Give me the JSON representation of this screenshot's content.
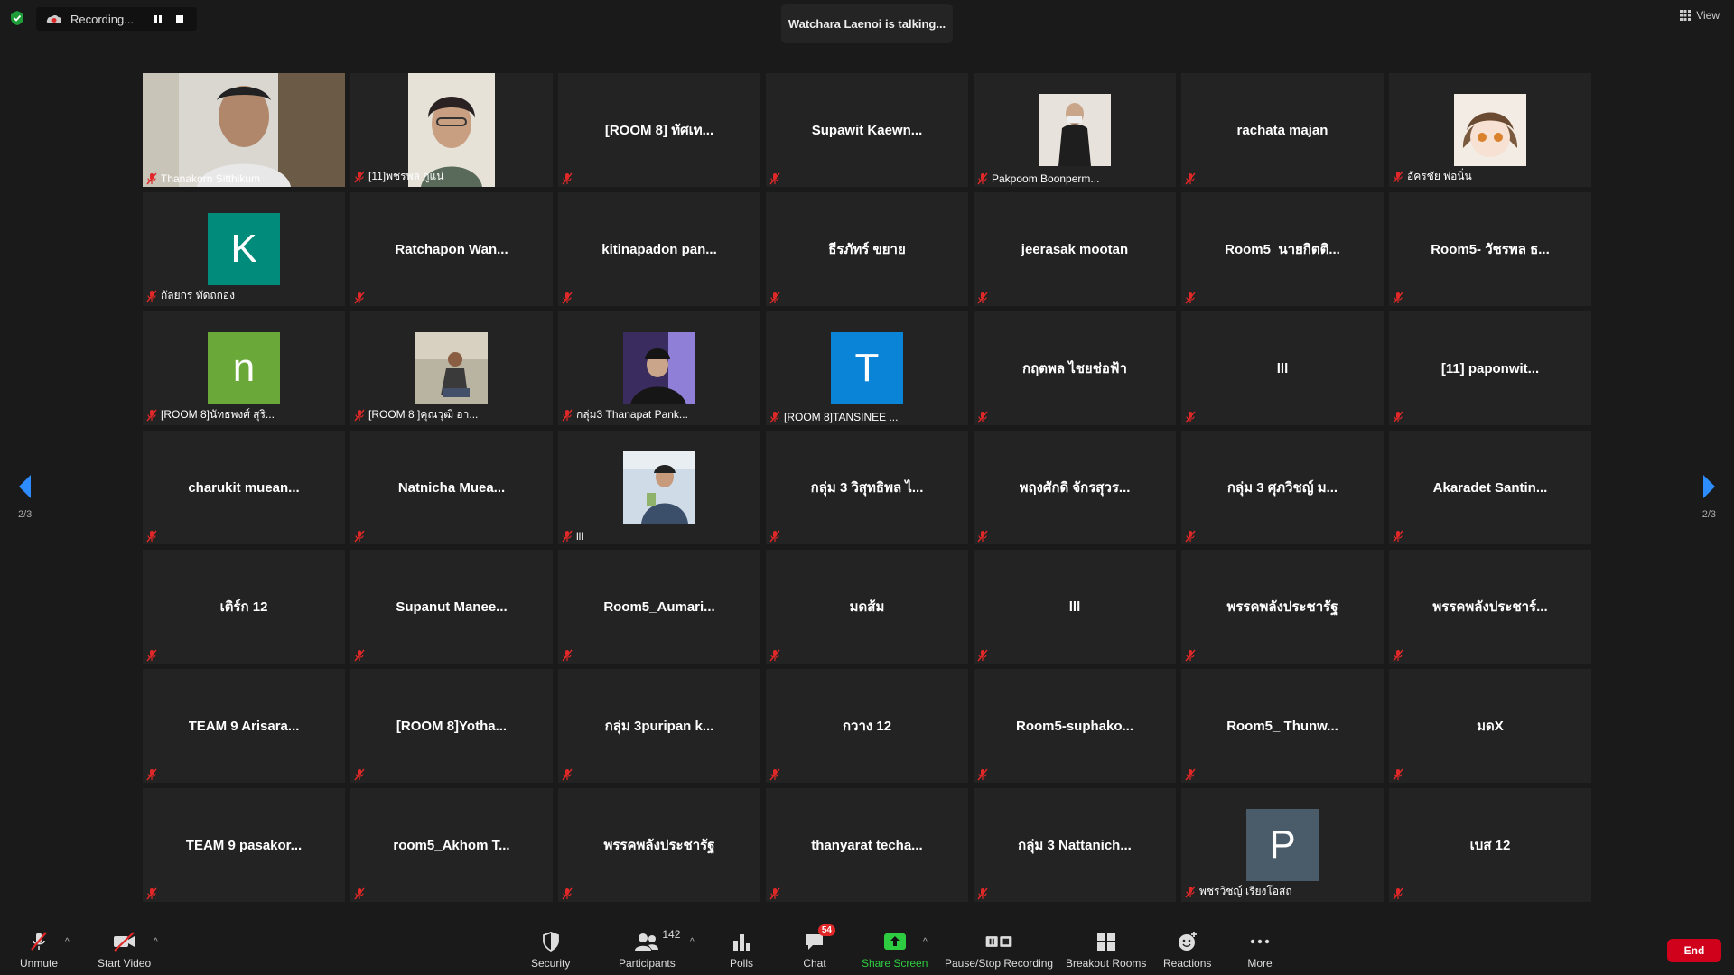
{
  "top": {
    "recording_label": "Recording...",
    "talking": "Watchara Laenoi is talking...",
    "view_label": "View"
  },
  "participants": [
    {
      "name": "",
      "foot": "Thanakorn Sitthikum",
      "kind": "photo",
      "photo": "boy"
    },
    {
      "name": "",
      "foot": "[11]พชรพล กูแน่",
      "kind": "photo",
      "photo": "girl"
    },
    {
      "name": "[ROOM 8] ทัศเท...",
      "foot": "",
      "kind": "name"
    },
    {
      "name": "Supawit  Kaewn...",
      "foot": "",
      "kind": "name"
    },
    {
      "name": "",
      "foot": "Pakpoom Boonperm...",
      "kind": "photo",
      "photo": "mask"
    },
    {
      "name": "rachata majan",
      "foot": "",
      "kind": "name"
    },
    {
      "name": "",
      "foot": "อัครชัย พ่อนิ่น",
      "kind": "photo",
      "photo": "anime"
    },
    {
      "name": "",
      "foot": "กัลยกร ทัดถกอง",
      "kind": "avatar",
      "letter": "K",
      "color": "#008b7a"
    },
    {
      "name": "Ratchapon  Wan...",
      "foot": "",
      "kind": "name"
    },
    {
      "name": "kitinapadon  pan...",
      "foot": "",
      "kind": "name"
    },
    {
      "name": "ธีรภัทร์ ขยาย",
      "foot": "",
      "kind": "name"
    },
    {
      "name": "jeerasak mootan",
      "foot": "",
      "kind": "name"
    },
    {
      "name": "Room5_นายกิตติ...",
      "foot": "",
      "kind": "name"
    },
    {
      "name": "Room5- วัชรพล ธ...",
      "foot": "",
      "kind": "name"
    },
    {
      "name": "",
      "foot": "[ROOM 8]นัทธพงศ์ สุริ...",
      "kind": "avatar",
      "letter": "n",
      "color": "#6aa83a"
    },
    {
      "name": "",
      "foot": "[ROOM 8 ]คุณวุฒิ อา...",
      "kind": "photo",
      "photo": "outdoor"
    },
    {
      "name": "",
      "foot": "กลุ่ม3 Thanapat Pank...",
      "kind": "photo",
      "photo": "purple"
    },
    {
      "name": "",
      "foot": "[ROOM 8]TANSINEE ...",
      "kind": "avatar",
      "letter": "T",
      "color": "#0a84d6"
    },
    {
      "name": "กฤตพล ไชยช่อฟ้า",
      "foot": "",
      "kind": "name"
    },
    {
      "name": "lll",
      "foot": "",
      "kind": "name"
    },
    {
      "name": "[11] paponwit...",
      "foot": "",
      "kind": "name"
    },
    {
      "name": "charukit  muean...",
      "foot": "",
      "kind": "name"
    },
    {
      "name": "Natnicha  Muea...",
      "foot": "",
      "kind": "name"
    },
    {
      "name": "",
      "foot": "lll",
      "kind": "photo",
      "photo": "phone"
    },
    {
      "name": "กลุ่ม 3 วิสุทธิพล ไ...",
      "foot": "",
      "kind": "name"
    },
    {
      "name": "พฤงศักดิ จักรสุวร...",
      "foot": "",
      "kind": "name"
    },
    {
      "name": "กลุ่ม 3 ศุภวิชญ์ ม...",
      "foot": "",
      "kind": "name"
    },
    {
      "name": "Akaradet  Santin...",
      "foot": "",
      "kind": "name"
    },
    {
      "name": "เติร์ก 12",
      "foot": "",
      "kind": "name"
    },
    {
      "name": "Supanut  Manee...",
      "foot": "",
      "kind": "name"
    },
    {
      "name": "Room5_Aumari...",
      "foot": "",
      "kind": "name"
    },
    {
      "name": "มดส้ม",
      "foot": "",
      "kind": "name"
    },
    {
      "name": "lll",
      "foot": "",
      "kind": "name"
    },
    {
      "name": "พรรคพลังประชารัฐ",
      "foot": "",
      "kind": "name"
    },
    {
      "name": "พรรคพลังประชาร์...",
      "foot": "",
      "kind": "name"
    },
    {
      "name": "TEAM 9 Arisara...",
      "foot": "",
      "kind": "name"
    },
    {
      "name": "[ROOM 8]Yotha...",
      "foot": "",
      "kind": "name"
    },
    {
      "name": "กลุ่ม 3puripan  k...",
      "foot": "",
      "kind": "name"
    },
    {
      "name": "กวาง 12",
      "foot": "",
      "kind": "name"
    },
    {
      "name": "Room5-suphako...",
      "foot": "",
      "kind": "name"
    },
    {
      "name": "Room5_  Thunw...",
      "foot": "",
      "kind": "name"
    },
    {
      "name": "มดX",
      "foot": "",
      "kind": "name"
    },
    {
      "name": "TEAM  9  pasakor...",
      "foot": "",
      "kind": "name"
    },
    {
      "name": "room5_Akhom  T...",
      "foot": "",
      "kind": "name"
    },
    {
      "name": "พรรคพลังประชารัฐ",
      "foot": "",
      "kind": "name"
    },
    {
      "name": "thanyarat  techa...",
      "foot": "",
      "kind": "name"
    },
    {
      "name": "กลุ่ม 3 Nattanich...",
      "foot": "",
      "kind": "name"
    },
    {
      "name": "",
      "foot": "พชรวิชญ์ เรียงโอสถ",
      "kind": "avatar",
      "letter": "P",
      "color": "#4a5c6a"
    },
    {
      "name": "เบส 12",
      "foot": "",
      "kind": "name"
    }
  ],
  "pager": {
    "left": "2/3",
    "right": "2/3"
  },
  "toolbar": {
    "unmute": "Unmute",
    "start_video": "Start Video",
    "security": "Security",
    "participants": "Participants",
    "participants_count": "142",
    "polls": "Polls",
    "chat": "Chat",
    "chat_badge": "54",
    "share_screen": "Share Screen",
    "pause_stop": "Pause/Stop Recording",
    "breakout": "Breakout Rooms",
    "reactions": "Reactions",
    "more": "More",
    "end": "End"
  },
  "colors": {
    "share_green": "#2ecc40",
    "end_red": "#d0021b",
    "muted_red": "#e02828"
  }
}
